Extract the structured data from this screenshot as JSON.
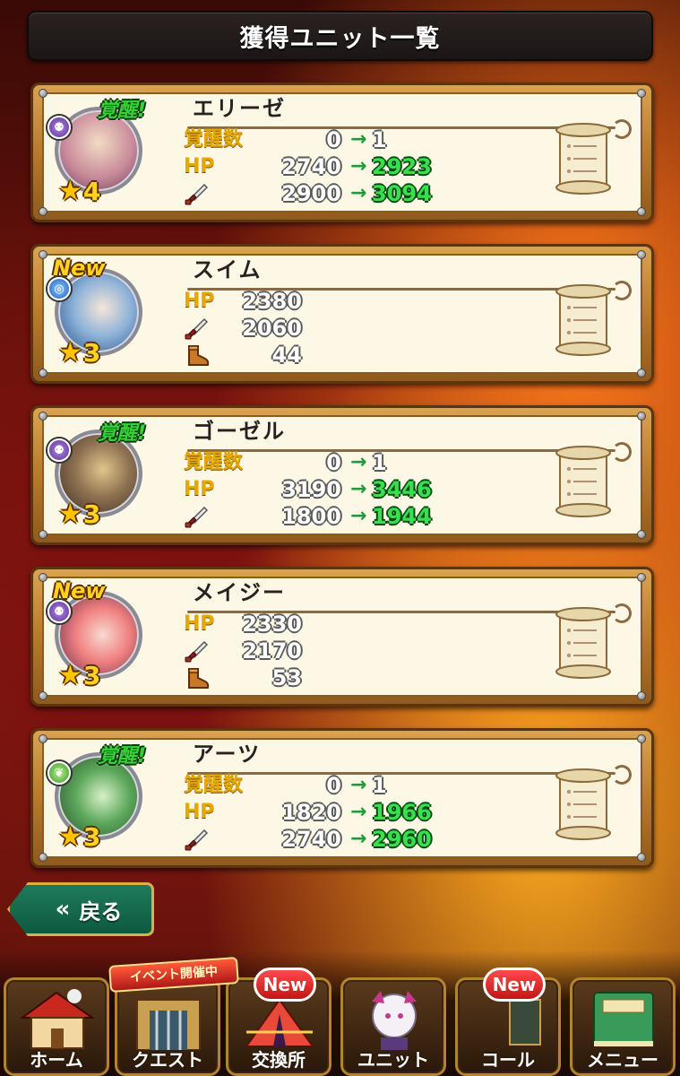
{
  "header": {
    "title": "獲得ユニット一覧"
  },
  "units": [
    {
      "name": "エリーゼ",
      "badge": "覚醒!",
      "badge_type": "awaken",
      "element": "dark",
      "rarity": "4",
      "stats": [
        {
          "label": "覚醒数",
          "old": "0",
          "arrow": "→",
          "new": "1"
        },
        {
          "label": "HP",
          "old": "2740",
          "arrow": "→",
          "new": "2923"
        },
        {
          "label": "sword-icon",
          "old": "2900",
          "arrow": "→",
          "new": "3094"
        }
      ]
    },
    {
      "name": "スイム",
      "badge": "New",
      "badge_type": "new",
      "element": "water",
      "rarity": "3",
      "stats": [
        {
          "label": "HP",
          "value": "2380"
        },
        {
          "label": "sword-icon",
          "value": "2060"
        },
        {
          "label": "boot-icon",
          "value": "44"
        }
      ]
    },
    {
      "name": "ゴーゼル",
      "badge": "覚醒!",
      "badge_type": "awaken",
      "element": "dark",
      "rarity": "3",
      "stats": [
        {
          "label": "覚醒数",
          "old": "0",
          "arrow": "→",
          "new": "1"
        },
        {
          "label": "HP",
          "old": "3190",
          "arrow": "→",
          "new": "3446"
        },
        {
          "label": "sword-icon",
          "old": "1800",
          "arrow": "→",
          "new": "1944"
        }
      ]
    },
    {
      "name": "メイジー",
      "badge": "New",
      "badge_type": "new",
      "element": "dark",
      "rarity": "3",
      "stats": [
        {
          "label": "HP",
          "value": "2330"
        },
        {
          "label": "sword-icon",
          "value": "2170"
        },
        {
          "label": "boot-icon",
          "value": "53"
        }
      ]
    },
    {
      "name": "アーツ",
      "badge": "覚醒!",
      "badge_type": "awaken",
      "element": "wind",
      "rarity": "3",
      "stats": [
        {
          "label": "覚醒数",
          "old": "0",
          "arrow": "→",
          "new": "1"
        },
        {
          "label": "HP",
          "old": "1820",
          "arrow": "→",
          "new": "1966"
        },
        {
          "label": "sword-icon",
          "old": "2740",
          "arrow": "→",
          "new": "2960"
        }
      ]
    }
  ],
  "back_button": {
    "icon": "double-chevron-left-icon",
    "label": "戻る"
  },
  "event_banner": "イベント開催中",
  "bottom_nav": [
    {
      "label": "ホーム",
      "icon": "house-icon",
      "new": false
    },
    {
      "label": "クエスト",
      "icon": "gate-icon",
      "new": false
    },
    {
      "label": "交換所",
      "icon": "tent-icon",
      "new": true,
      "new_label": "New"
    },
    {
      "label": "ユニット",
      "icon": "character-icon",
      "new": false
    },
    {
      "label": "コール",
      "icon": "crescent-icon",
      "new": true,
      "new_label": "New"
    },
    {
      "label": "メニュー",
      "icon": "book-icon",
      "new": false
    }
  ],
  "colors": {
    "accent_green": "#38e050",
    "label_gold": "#e6a800",
    "new_red": "#c01616",
    "awaken_green": "#38d038"
  }
}
